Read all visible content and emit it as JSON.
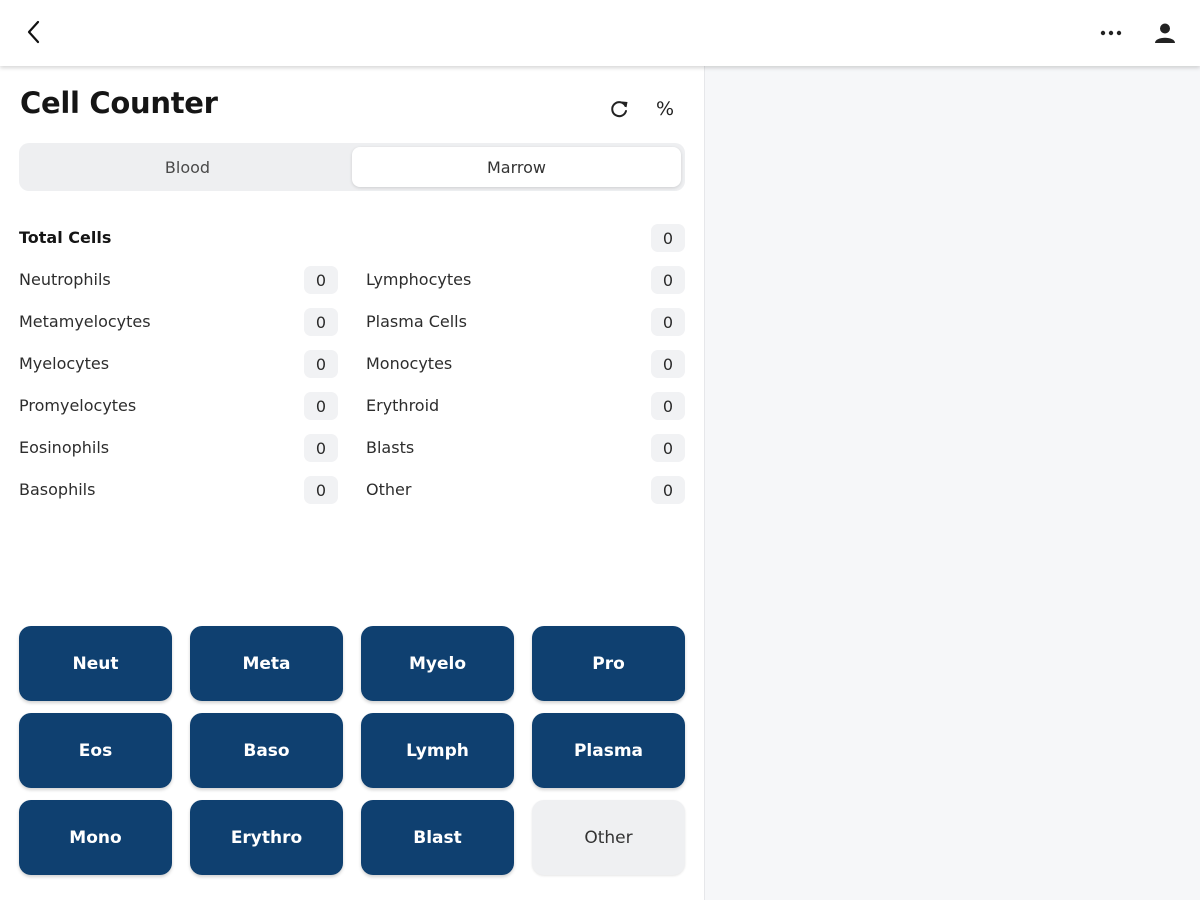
{
  "header": {
    "back_icon": "chevron-left-icon",
    "more_icon": "ellipsis-icon",
    "user_icon": "person-icon"
  },
  "main": {
    "title": "Cell Counter",
    "reset_icon": "refresh-icon",
    "percent_label": "%",
    "tabs": [
      {
        "label": "Blood",
        "active": false
      },
      {
        "label": "Marrow",
        "active": true
      }
    ],
    "total": {
      "label": "Total Cells",
      "value": "0"
    },
    "counts_left": [
      {
        "label": "Neutrophils",
        "value": "0"
      },
      {
        "label": "Metamyelocytes",
        "value": "0"
      },
      {
        "label": "Myelocytes",
        "value": "0"
      },
      {
        "label": "Promyelocytes",
        "value": "0"
      },
      {
        "label": "Eosinophils",
        "value": "0"
      },
      {
        "label": "Basophils",
        "value": "0"
      }
    ],
    "counts_right": [
      {
        "label": "Lymphocytes",
        "value": "0"
      },
      {
        "label": "Plasma Cells",
        "value": "0"
      },
      {
        "label": "Monocytes",
        "value": "0"
      },
      {
        "label": "Erythroid",
        "value": "0"
      },
      {
        "label": "Blasts",
        "value": "0"
      },
      {
        "label": "Other",
        "value": "0"
      }
    ],
    "buttons": [
      {
        "label": "Neut"
      },
      {
        "label": "Meta"
      },
      {
        "label": "Myelo"
      },
      {
        "label": "Pro"
      },
      {
        "label": "Eos"
      },
      {
        "label": "Baso"
      },
      {
        "label": "Lymph"
      },
      {
        "label": "Plasma"
      },
      {
        "label": "Mono"
      },
      {
        "label": "Erythro"
      },
      {
        "label": "Blast"
      },
      {
        "label": "Other"
      }
    ]
  },
  "colors": {
    "primary_button": "#0f4070",
    "secondary_button": "#eff0f2",
    "panel_background": "#f6f7f9"
  }
}
